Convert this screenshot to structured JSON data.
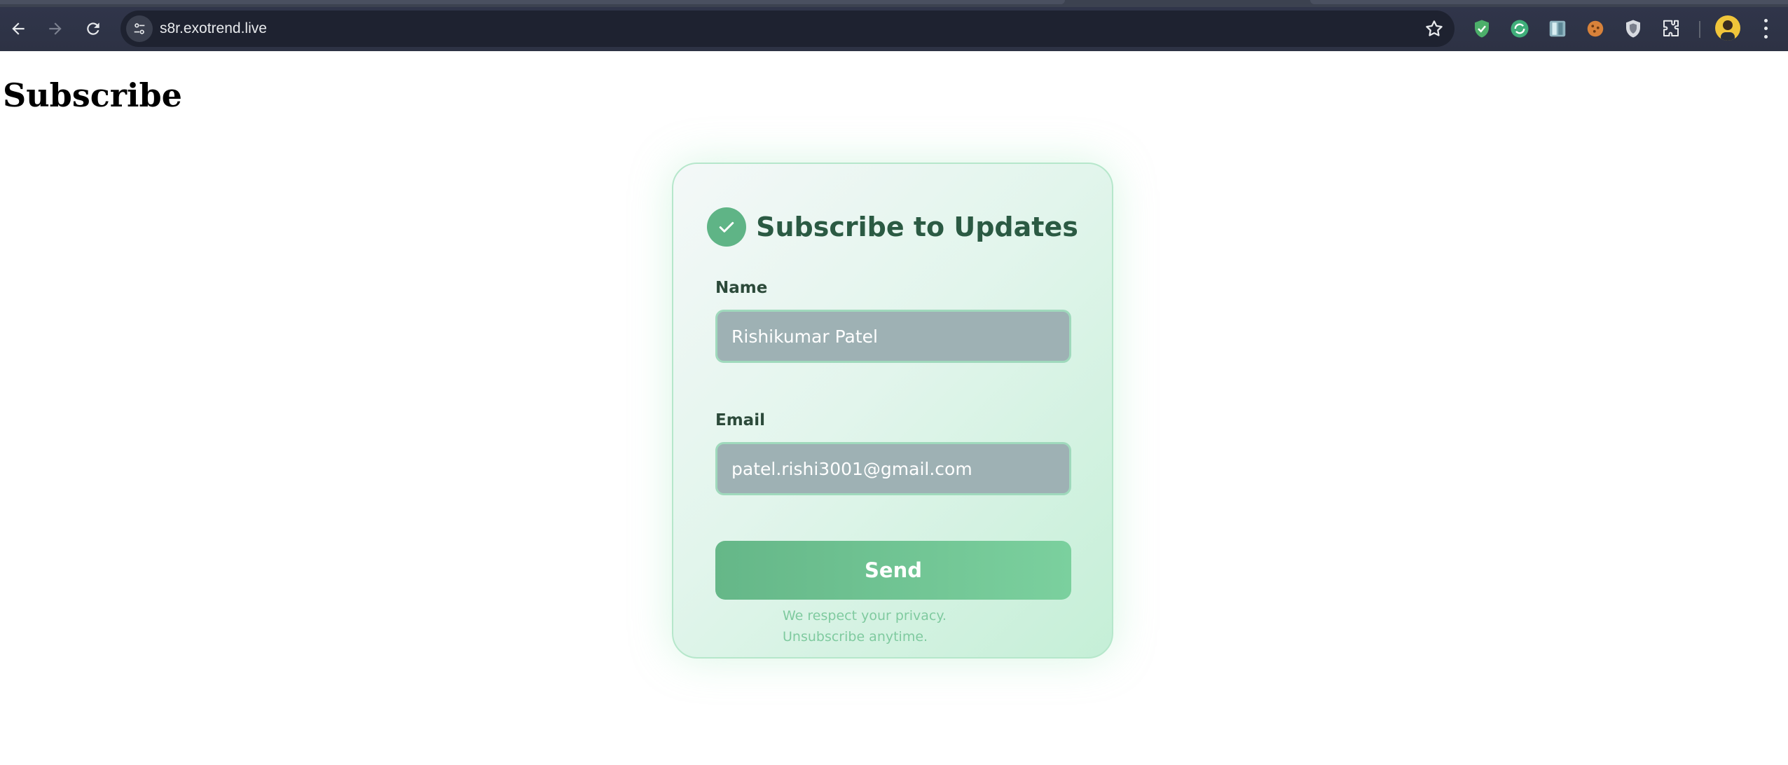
{
  "browser": {
    "url": "s8r.exotrend.live",
    "icons": [
      "back-arrow-icon",
      "forward-arrow-icon",
      "reload-icon",
      "site-info-icon",
      "star-icon",
      "shield-extension-icon",
      "sync-extension-icon",
      "book-extension-icon",
      "cookie-extension-icon",
      "privacy-badger-extension-icon",
      "puzzle-extensions-icon",
      "profile-avatar",
      "menu-dots-icon"
    ]
  },
  "page": {
    "heading": "Subscribe"
  },
  "form": {
    "title": "Subscribe to Updates",
    "name_label": "Name",
    "name_value": "Rishikumar Patel",
    "email_label": "Email",
    "email_value": "patel.rishi3001@gmail.com",
    "submit_label": "Send",
    "privacy_line1": "We respect your privacy.",
    "privacy_line2": "Unsubscribe anytime."
  },
  "colors": {
    "accent": "#5fb486",
    "title": "#2b5a43",
    "input_bg": "#9eb1b4",
    "privacy_text": "#7fca9f"
  }
}
